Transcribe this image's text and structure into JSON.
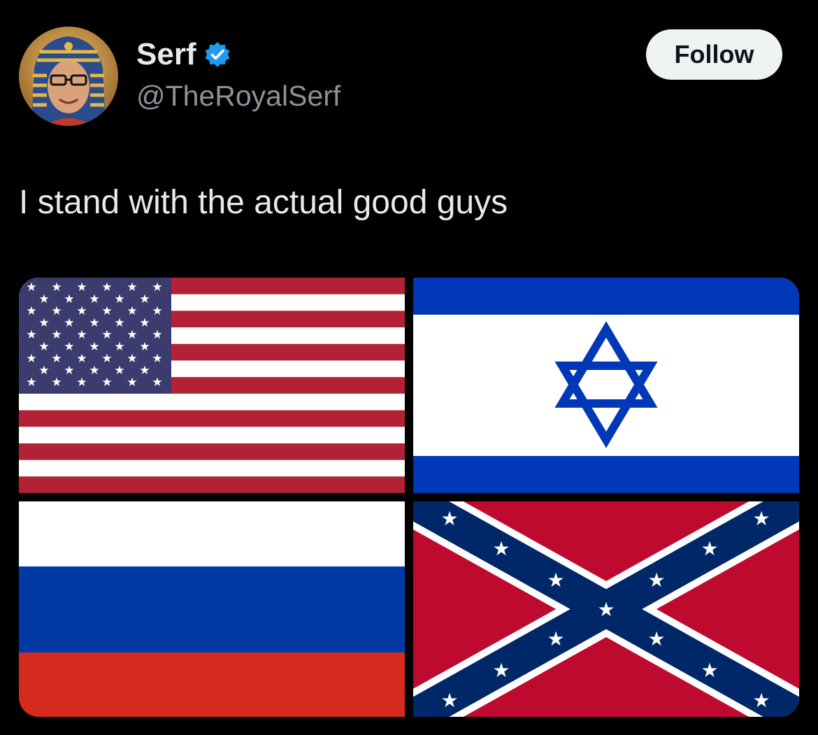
{
  "user": {
    "display_name": "Serf",
    "handle": "@TheRoyalSerf",
    "verified_icon": "verified-badge-icon",
    "avatar": "pharaoh-avatar"
  },
  "follow_button": {
    "label": "Follow"
  },
  "tweet": {
    "text": "I stand with the actual good guys"
  },
  "media": {
    "images": [
      {
        "name": "united-states-flag"
      },
      {
        "name": "israel-flag"
      },
      {
        "name": "russia-flag"
      },
      {
        "name": "confederate-battle-flag"
      }
    ]
  },
  "colors": {
    "background": "#000000",
    "verified_blue": "#1d9bf0",
    "handle_gray": "#8b9299"
  }
}
